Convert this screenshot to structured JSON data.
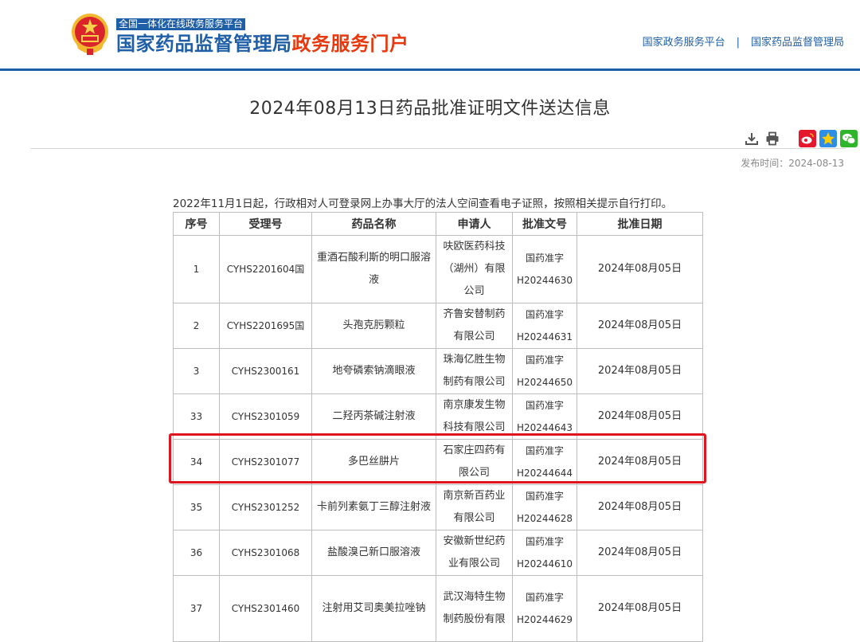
{
  "header": {
    "platform_label": "全国一体化在线政务服务平台",
    "portal_title_main": "国家药品监督管理局",
    "portal_title_accent": "政务服务门户",
    "links": [
      "国家政务服务平台",
      "国家药品监督管理局"
    ],
    "link_separator": "|"
  },
  "article": {
    "title": "2024年08月13日药品批准证明文件送达信息",
    "publish_time": "发布时间：2024-08-13",
    "notice": "2022年11月1日起，行政相对人可登录网上办事大厅的法人空间查看电子证照，按照相关提示自行打印。"
  },
  "colors": {
    "brand_blue": "#1f5fa8",
    "accent_orange": "#e8380d",
    "highlight_red": "#e0141e"
  },
  "icons": [
    "download-icon",
    "print-icon",
    "weibo-icon",
    "qzone-icon",
    "wechat-icon"
  ],
  "table": {
    "headers": [
      "序号",
      "受理号",
      "药品名称",
      "申请人",
      "批准文号",
      "批准日期"
    ],
    "rows": [
      {
        "no": "1",
        "accept": "CYHS2201604国",
        "drug": "重酒石酸利斯的明口服溶液",
        "applicant": "呋欧医药科技（湖州）有限公司",
        "approval": "国药准字H20244630",
        "date": "2024年08月05日"
      },
      {
        "no": "2",
        "accept": "CYHS2201695国",
        "drug": "头孢克肟颗粒",
        "applicant": "齐鲁安替制药有限公司",
        "approval": "国药准字H20244631",
        "date": "2024年08月05日"
      },
      {
        "no": "3",
        "accept": "CYHS2300161",
        "drug": "地夸磷索钠滴眼液",
        "applicant": "珠海亿胜生物制药有限公司",
        "approval": "国药准字H20244650",
        "date": "2024年08月05日"
      },
      {
        "no": "33",
        "accept": "CYHS2301059",
        "drug": "二羟丙茶碱注射液",
        "applicant": "南京康发生物科技有限公司",
        "approval": "国药准字H20244643",
        "date": "2024年08月05日"
      },
      {
        "no": "34",
        "accept": "CYHS2301077",
        "drug": "多巴丝肼片",
        "applicant": "石家庄四药有限公司",
        "approval": "国药准字H20244644",
        "date": "2024年08月05日"
      },
      {
        "no": "35",
        "accept": "CYHS2301252",
        "drug": "卡前列素氨丁三醇注射液",
        "applicant": "南京新百药业有限公司",
        "approval": "国药准字H20244628",
        "date": "2024年08月05日"
      },
      {
        "no": "36",
        "accept": "CYHS2301068",
        "drug": "盐酸溴己新口服溶液",
        "applicant": "安徽新世纪药业有限公司",
        "approval": "国药准字H20244610",
        "date": "2024年08月05日"
      },
      {
        "no": "37",
        "accept": "CYHS2301460",
        "drug": "注射用艾司奥美拉唑钠",
        "applicant": "武汉海特生物制药股份有限",
        "approval": "国药准字H20244629",
        "date": "2024年08月05日"
      }
    ]
  }
}
